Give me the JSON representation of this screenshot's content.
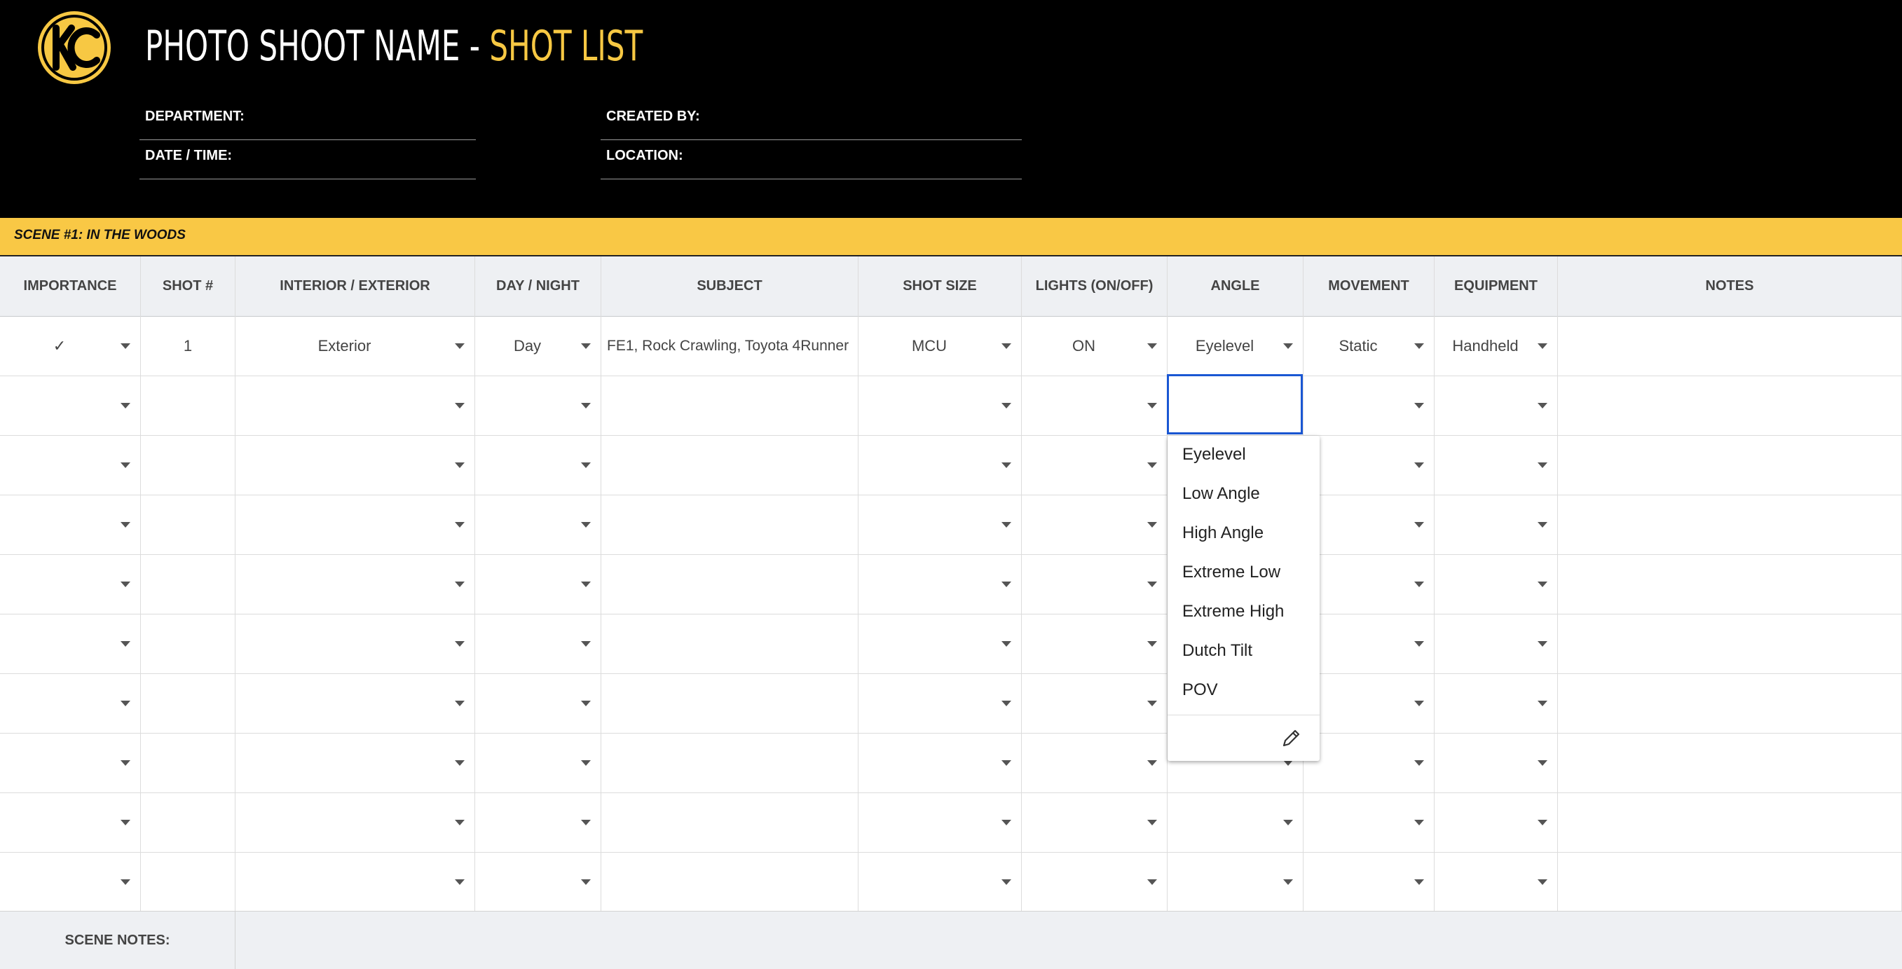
{
  "header": {
    "title_main": "PHOTO SHOOT NAME - ",
    "title_accent": "SHOT LIST",
    "department_label": "DEPARTMENT:",
    "created_by_label": "CREATED BY:",
    "date_time_label": "DATE / TIME:",
    "location_label": "LOCATION:",
    "logo_icon": "kc-logo-icon",
    "accent_color": "#f7c843"
  },
  "scene": {
    "title": "SCENE #1: IN THE WOODS",
    "notes_label": "SCENE NOTES:"
  },
  "table": {
    "columns": [
      "IMPORTANCE",
      "SHOT #",
      "INTERIOR / EXTERIOR",
      "DAY / NIGHT",
      "SUBJECT",
      "SHOT SIZE",
      "LIGHTS (ON/OFF)",
      "ANGLE",
      "MOVEMENT",
      "EQUIPMENT",
      "NOTES"
    ],
    "rows": [
      {
        "importance": "✓",
        "shot": "1",
        "int_ext": "Exterior",
        "day_night": "Day",
        "subject": "FE1, Rock Crawling, Toyota 4Runner",
        "shot_size": "MCU",
        "lights": "ON",
        "angle": "Eyelevel",
        "movement": "Static",
        "equipment": "Handheld",
        "notes": ""
      },
      {
        "importance": "",
        "shot": "",
        "int_ext": "",
        "day_night": "",
        "subject": "",
        "shot_size": "",
        "lights": "",
        "angle": "",
        "movement": "",
        "equipment": "",
        "notes": ""
      },
      {
        "importance": "",
        "shot": "",
        "int_ext": "",
        "day_night": "",
        "subject": "",
        "shot_size": "",
        "lights": "",
        "angle": "",
        "movement": "",
        "equipment": "",
        "notes": ""
      },
      {
        "importance": "",
        "shot": "",
        "int_ext": "",
        "day_night": "",
        "subject": "",
        "shot_size": "",
        "lights": "",
        "angle": "",
        "movement": "",
        "equipment": "",
        "notes": ""
      },
      {
        "importance": "",
        "shot": "",
        "int_ext": "",
        "day_night": "",
        "subject": "",
        "shot_size": "",
        "lights": "",
        "angle": "",
        "movement": "",
        "equipment": "",
        "notes": ""
      },
      {
        "importance": "",
        "shot": "",
        "int_ext": "",
        "day_night": "",
        "subject": "",
        "shot_size": "",
        "lights": "",
        "angle": "",
        "movement": "",
        "equipment": "",
        "notes": ""
      },
      {
        "importance": "",
        "shot": "",
        "int_ext": "",
        "day_night": "",
        "subject": "",
        "shot_size": "",
        "lights": "",
        "angle": "",
        "movement": "",
        "equipment": "",
        "notes": ""
      },
      {
        "importance": "",
        "shot": "",
        "int_ext": "",
        "day_night": "",
        "subject": "",
        "shot_size": "",
        "lights": "",
        "angle": "",
        "movement": "",
        "equipment": "",
        "notes": ""
      },
      {
        "importance": "",
        "shot": "",
        "int_ext": "",
        "day_night": "",
        "subject": "",
        "shot_size": "",
        "lights": "",
        "angle": "",
        "movement": "",
        "equipment": "",
        "notes": ""
      },
      {
        "importance": "",
        "shot": "",
        "int_ext": "",
        "day_night": "",
        "subject": "",
        "shot_size": "",
        "lights": "",
        "angle": "",
        "movement": "",
        "equipment": "",
        "notes": ""
      }
    ]
  },
  "angle_dropdown": {
    "options": [
      "Eyelevel",
      "Low Angle",
      "High Angle",
      "Extreme Low",
      "Extreme High",
      "Dutch Tilt",
      "POV"
    ],
    "edit_icon": "pencil-icon"
  }
}
